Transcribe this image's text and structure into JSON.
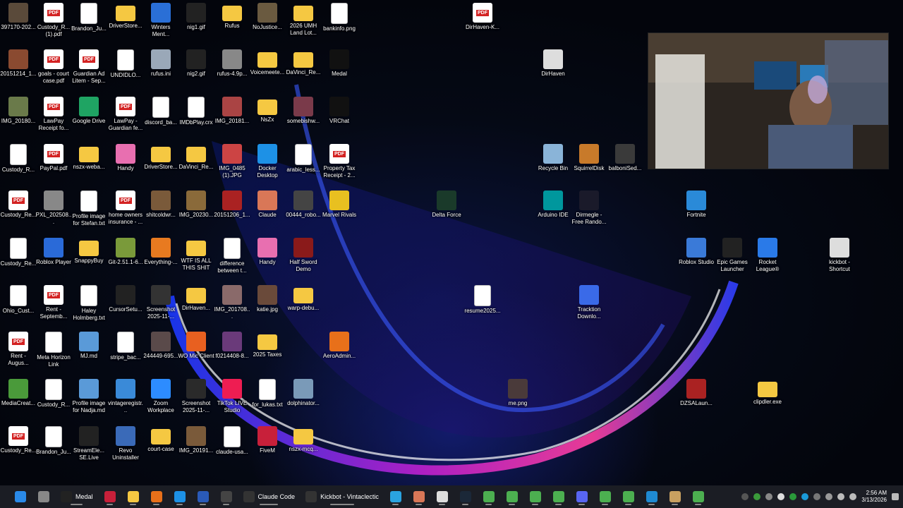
{
  "desktop": {
    "icons": [
      {
        "label": "397170-202...",
        "kind": "photo",
        "color": "#5a4a3a"
      },
      {
        "label": "Custody_R... (1).pdf",
        "kind": "pdf"
      },
      {
        "label": "Brandon_Ju...",
        "kind": "txt"
      },
      {
        "label": "DriverStore...",
        "kind": "folder"
      },
      {
        "label": "Winters Ment...",
        "kind": "app",
        "color": "#2a6fd6"
      },
      {
        "label": "nig1.gif",
        "kind": "photo",
        "color": "#222"
      },
      {
        "label": "Rufus",
        "kind": "folder"
      },
      {
        "label": "NoJustice...",
        "kind": "photo",
        "color": "#6a5a40"
      },
      {
        "label": "2026 UMH Land Lot...",
        "kind": "folder"
      },
      {
        "label": "bankinfo.png",
        "kind": "txt"
      },
      {
        "label": "DirHaven-K...",
        "kind": "pdf"
      },
      {
        "label": "20151214_1...",
        "kind": "photo",
        "color": "#8a4a30"
      },
      {
        "label": "goals - court case.pdf",
        "kind": "pdf"
      },
      {
        "label": "Guardian Ad Litem - Sep...",
        "kind": "pdf"
      },
      {
        "label": "UNDIDLO...",
        "kind": "txt"
      },
      {
        "label": "rufus.ini",
        "kind": "app",
        "color": "#9aa8b8"
      },
      {
        "label": "nig2.gif",
        "kind": "photo",
        "color": "#222"
      },
      {
        "label": "rufus-4.9p...",
        "kind": "app",
        "color": "#888"
      },
      {
        "label": "Voicemeete...",
        "kind": "folder"
      },
      {
        "label": "DaVinci_Re...",
        "kind": "folder"
      },
      {
        "label": "Medal",
        "kind": "app",
        "color": "#111"
      },
      {
        "label": "DirHaven",
        "kind": "app",
        "color": "#ddd"
      },
      {
        "label": "IMG_20180...",
        "kind": "photo",
        "color": "#6a7a4a"
      },
      {
        "label": "LawPay Receipt fo...",
        "kind": "pdf"
      },
      {
        "label": "Google Drive",
        "kind": "app",
        "color": "#1fa463"
      },
      {
        "label": "LawPay - Guardian fe...",
        "kind": "pdf"
      },
      {
        "label": "discord_ba...",
        "kind": "txt"
      },
      {
        "label": "IMDbPlay.crx",
        "kind": "txt"
      },
      {
        "label": "IMG_20181...",
        "kind": "photo",
        "color": "#aa4444"
      },
      {
        "label": "NsZx",
        "kind": "folder"
      },
      {
        "label": "somebishw...",
        "kind": "photo",
        "color": "#7a3a4a"
      },
      {
        "label": "VRChat",
        "kind": "app",
        "color": "#111"
      },
      {
        "label": "Custody_R...",
        "kind": "txt"
      },
      {
        "label": "PayPal.pdf",
        "kind": "pdf"
      },
      {
        "label": "nszx-weba...",
        "kind": "folder"
      },
      {
        "label": "Handy",
        "kind": "app",
        "color": "#e86fb0"
      },
      {
        "label": "DriverStore...",
        "kind": "folder"
      },
      {
        "label": "DaVinci_Re...",
        "kind": "folder"
      },
      {
        "label": "IMG_0485 (1).JPG",
        "kind": "photo",
        "color": "#cc4444"
      },
      {
        "label": "Docker Desktop",
        "kind": "app",
        "color": "#1d91e6"
      },
      {
        "label": "arabic_less...",
        "kind": "txt"
      },
      {
        "label": "Property Tax Receipt - 2...",
        "kind": "pdf"
      },
      {
        "label": "Recycle Bin",
        "kind": "app",
        "color": "#8ab4d8"
      },
      {
        "label": "SquirrelDisk",
        "kind": "app",
        "color": "#c87a2a"
      },
      {
        "label": "balboniSed...",
        "kind": "photo",
        "color": "#3a3a3a"
      },
      {
        "label": "Custody_Re...",
        "kind": "pdf"
      },
      {
        "label": "PXL_202508...",
        "kind": "photo",
        "color": "#888"
      },
      {
        "label": "Profile image for Stefan.txt",
        "kind": "txt"
      },
      {
        "label": "home owners insurance - ...",
        "kind": "pdf"
      },
      {
        "label": "shitcoldwr...",
        "kind": "photo",
        "color": "#7a5a3a"
      },
      {
        "label": "IMG_20230...",
        "kind": "photo",
        "color": "#8a6a3a"
      },
      {
        "label": "20151206_1...",
        "kind": "photo",
        "color": "#aa2222"
      },
      {
        "label": "Claude",
        "kind": "app",
        "color": "#d97757"
      },
      {
        "label": "00444_robo...",
        "kind": "photo",
        "color": "#444"
      },
      {
        "label": "Marvel Rivals",
        "kind": "app",
        "color": "#e8c020"
      },
      {
        "label": "Delta Force",
        "kind": "app",
        "color": "#1a3a2a"
      },
      {
        "label": "Arduino IDE",
        "kind": "app",
        "color": "#00979d"
      },
      {
        "label": "Dirmegle - Free Rando...",
        "kind": "app",
        "color": "#1a1a2a"
      },
      {
        "label": "Fortnite",
        "kind": "app",
        "color": "#2a8ad8"
      },
      {
        "label": "Custody_Re...",
        "kind": "txt"
      },
      {
        "label": "Roblox Player",
        "kind": "app",
        "color": "#2a6ad8"
      },
      {
        "label": "SnappyBuy",
        "kind": "folder"
      },
      {
        "label": "Git-2.51.1-6...",
        "kind": "app",
        "color": "#7a9a3a"
      },
      {
        "label": "Everything-...",
        "kind": "app",
        "color": "#e87a20"
      },
      {
        "label": "WTF IS ALL THIS SHIT",
        "kind": "folder"
      },
      {
        "label": "difference between t...",
        "kind": "txt"
      },
      {
        "label": "Handy",
        "kind": "app",
        "color": "#e86fb0"
      },
      {
        "label": "Half Sword Demo",
        "kind": "app",
        "color": "#8a1a1a"
      },
      {
        "label": "Roblox Studio",
        "kind": "app",
        "color": "#3a7ad8"
      },
      {
        "label": "Epic Games Launcher",
        "kind": "app",
        "color": "#222"
      },
      {
        "label": "Rocket League®",
        "kind": "app",
        "color": "#2a7ae8"
      },
      {
        "label": "kickbot - Shortcut",
        "kind": "app",
        "color": "#ddd"
      },
      {
        "label": "Ohio_Cust...",
        "kind": "txt"
      },
      {
        "label": "Rent - Septemb...",
        "kind": "pdf"
      },
      {
        "label": "Haley Holmberg.txt",
        "kind": "txt"
      },
      {
        "label": "CursorSetu...",
        "kind": "app",
        "color": "#222"
      },
      {
        "label": "Screenshot 2025-11-...",
        "kind": "photo",
        "color": "#333"
      },
      {
        "label": "DirHaven...",
        "kind": "folder"
      },
      {
        "label": "IMG_201708...",
        "kind": "photo",
        "color": "#8a6a6a"
      },
      {
        "label": "katie.jpg",
        "kind": "photo",
        "color": "#6a4a3a"
      },
      {
        "label": "warp-debu...",
        "kind": "folder"
      },
      {
        "label": "resume2025...",
        "kind": "txt"
      },
      {
        "label": "Tracktion Downlo...",
        "kind": "app",
        "color": "#3a6ae8"
      },
      {
        "label": "Rent - Augus...",
        "kind": "pdf"
      },
      {
        "label": "Meta Horizon Link",
        "kind": "txt"
      },
      {
        "label": "MJ.md",
        "kind": "app",
        "color": "#5a9ad8"
      },
      {
        "label": "stripe_bac...",
        "kind": "txt"
      },
      {
        "label": "244449-695...",
        "kind": "photo",
        "color": "#5a4a4a"
      },
      {
        "label": "WO Mic Client",
        "kind": "app",
        "color": "#e86020"
      },
      {
        "label": "f0214408-8...",
        "kind": "photo",
        "color": "#6a3a7a"
      },
      {
        "label": "2025 Taxes",
        "kind": "folder"
      },
      {
        "label": "AeroAdmin...",
        "kind": "app",
        "color": "#e8701a"
      },
      {
        "label": "MediaCreat...",
        "kind": "app",
        "color": "#4a9a3a"
      },
      {
        "label": "Custody_R...",
        "kind": "txt"
      },
      {
        "label": "Profile image for Nadja.md",
        "kind": "app",
        "color": "#5a9ad8"
      },
      {
        "label": "vintageregistr...",
        "kind": "app",
        "color": "#3a8ad8"
      },
      {
        "label": "Zoom Workplace",
        "kind": "app",
        "color": "#2d8cff"
      },
      {
        "label": "Screenshot 2025-11-...",
        "kind": "photo",
        "color": "#2a2a2a"
      },
      {
        "label": "TikTok LIVE Studio",
        "kind": "app",
        "color": "#ee1d52"
      },
      {
        "label": "for_lukas.txt",
        "kind": "txt"
      },
      {
        "label": "dolphinator...",
        "kind": "app",
        "color": "#7a9ab8"
      },
      {
        "label": "me.png",
        "kind": "photo",
        "color": "#4a3a3a"
      },
      {
        "label": "DZSALaun...",
        "kind": "app",
        "color": "#aa2222"
      },
      {
        "label": "clipdler.exe",
        "kind": "folder"
      },
      {
        "label": "Custody_Re...",
        "kind": "pdf"
      },
      {
        "label": "Brandon_Ju...",
        "kind": "txt"
      },
      {
        "label": "StreamEle... SE.Live",
        "kind": "app",
        "color": "#222"
      },
      {
        "label": "Revo Uninstaller",
        "kind": "app",
        "color": "#3a6ab8"
      },
      {
        "label": "court-case",
        "kind": "folder"
      },
      {
        "label": "IMG_20191...",
        "kind": "photo",
        "color": "#7a5a3a"
      },
      {
        "label": "claude-usa...",
        "kind": "txt"
      },
      {
        "label": "FiveM",
        "kind": "app",
        "color": "#c8203a"
      },
      {
        "label": "nszx-mcq...",
        "kind": "folder"
      }
    ]
  },
  "taskbar": {
    "apps": [
      {
        "name": "start-button",
        "color": "#2a8ae8",
        "label": ""
      },
      {
        "name": "task-view",
        "color": "#888",
        "label": ""
      },
      {
        "name": "medal",
        "color": "#222",
        "label": "Medal"
      },
      {
        "name": "affinity",
        "color": "#c8203a",
        "label": ""
      },
      {
        "name": "file-explorer",
        "color": "#f5c842",
        "label": ""
      },
      {
        "name": "firefox",
        "color": "#e8701a",
        "label": ""
      },
      {
        "name": "edge",
        "color": "#1d91e6",
        "label": ""
      },
      {
        "name": "powershell",
        "color": "#2a5ab8",
        "label": ""
      },
      {
        "name": "terminal",
        "color": "#444",
        "label": ""
      },
      {
        "name": "terminal-claude",
        "color": "#333",
        "label": "Claude Code"
      },
      {
        "name": "terminal-kickbot",
        "color": "#333",
        "label": "Kickbot - Vintaclectic"
      },
      {
        "name": "telegram",
        "color": "#2aa3e0",
        "label": ""
      },
      {
        "name": "claude-app",
        "color": "#d97757",
        "label": ""
      },
      {
        "name": "app-a",
        "color": "#ddd",
        "label": ""
      },
      {
        "name": "steam",
        "color": "#1b2838",
        "label": ""
      },
      {
        "name": "chrome-1",
        "color": "#4caf50",
        "label": ""
      },
      {
        "name": "chrome-2",
        "color": "#4caf50",
        "label": ""
      },
      {
        "name": "chrome-3",
        "color": "#4caf50",
        "label": ""
      },
      {
        "name": "chrome-4",
        "color": "#4caf50",
        "label": ""
      },
      {
        "name": "discord",
        "color": "#5865f2",
        "label": ""
      },
      {
        "name": "chrome-5",
        "color": "#4caf50",
        "label": ""
      },
      {
        "name": "chrome-6",
        "color": "#4caf50",
        "label": ""
      },
      {
        "name": "vscode",
        "color": "#1f8ad2",
        "label": ""
      },
      {
        "name": "app-b",
        "color": "#c8a060",
        "label": ""
      },
      {
        "name": "chrome-7",
        "color": "#4caf50",
        "label": ""
      }
    ],
    "clock": {
      "time": "2:56 AM",
      "date": "3/13/2026"
    }
  }
}
